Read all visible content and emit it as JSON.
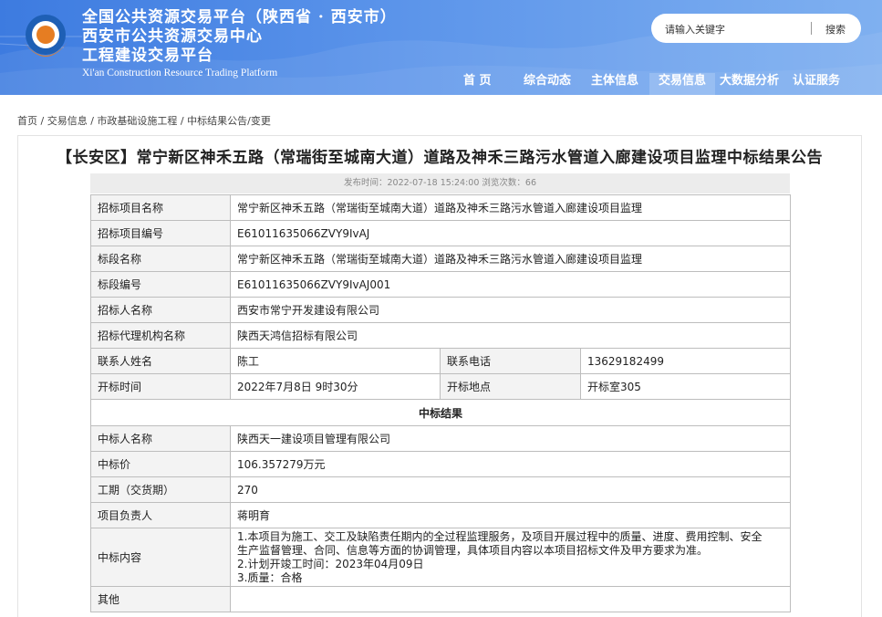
{
  "header": {
    "title_line1": "全国公共资源交易平台（陕西省 · 西安市）",
    "title_line2": "西安市公共资源交易中心",
    "title_line3": "工程建设交易平台",
    "title_en": "Xi'an Construction Resource Trading Platform",
    "logo_icon": "trading-center-logo",
    "search": {
      "placeholder": "请输入关键字",
      "button_label": "搜索"
    }
  },
  "nav": {
    "items": [
      {
        "label": "首  页",
        "active": false
      },
      {
        "label": "综合动态",
        "active": false
      },
      {
        "label": "主体信息",
        "active": false
      },
      {
        "label": "交易信息",
        "active": true
      },
      {
        "label": "大数据分析",
        "active": false
      },
      {
        "label": "认证服务",
        "active": false
      }
    ]
  },
  "breadcrumb": {
    "home": "首页",
    "sep": " / ",
    "level2": "交易信息",
    "level3": "市政基础设施工程",
    "level4": "中标结果公告/变更"
  },
  "article": {
    "title": "【长安区】常宁新区神禾五路（常瑞街至城南大道）道路及神禾三路污水管道入廊建设项目监理中标结果公告",
    "meta": "发布时间：2022-07-18 15:24:00 浏览次数：66"
  },
  "table": {
    "rows": {
      "project_name": {
        "label": "招标项目名称",
        "value": "常宁新区神禾五路（常瑞街至城南大道）道路及神禾三路污水管道入廊建设项目监理"
      },
      "project_code": {
        "label": "招标项目编号",
        "value": "E61011635066ZVY9IvAJ"
      },
      "section_name": {
        "label": "标段名称",
        "value": "常宁新区神禾五路（常瑞街至城南大道）道路及神禾三路污水管道入廊建设项目监理"
      },
      "section_code": {
        "label": "标段编号",
        "value": "E61011635066ZVY9IvAJ001"
      },
      "tenderer": {
        "label": "招标人名称",
        "value": "西安市常宁开发建设有限公司"
      },
      "agency": {
        "label": "招标代理机构名称",
        "value": "陕西天鸿信招标有限公司"
      },
      "contact": {
        "label": "联系人姓名",
        "value": "陈工",
        "label2": "联系电话",
        "value2": "13629182499"
      },
      "opening": {
        "label": "开标时间",
        "value": "2022年7月8日 9时30分",
        "label2": "开标地点",
        "value2": "开标室305"
      }
    },
    "result_heading": "中标结果",
    "result": {
      "winner": {
        "label": "中标人名称",
        "value": "陕西天一建设项目管理有限公司"
      },
      "price": {
        "label": "中标价",
        "value": "106.357279万元"
      },
      "period": {
        "label": "工期（交货期）",
        "value": "270"
      },
      "manager": {
        "label": "项目负责人",
        "value": "蒋明育"
      },
      "content": {
        "label": "中标内容",
        "lines": [
          "1.本项目为施工、交工及缺陷责任期内的全过程监理服务，及项目开展过程中的质量、进度、费用控制、安全",
          "生产监督管理、合同、信息等方面的协调管理，具体项目内容以本项目招标文件及甲方要求为准。",
          "2.计划开竣工时间：2023年04月09日",
          "3.质量：合格"
        ]
      },
      "other": {
        "label": "其他",
        "value": ""
      }
    }
  }
}
